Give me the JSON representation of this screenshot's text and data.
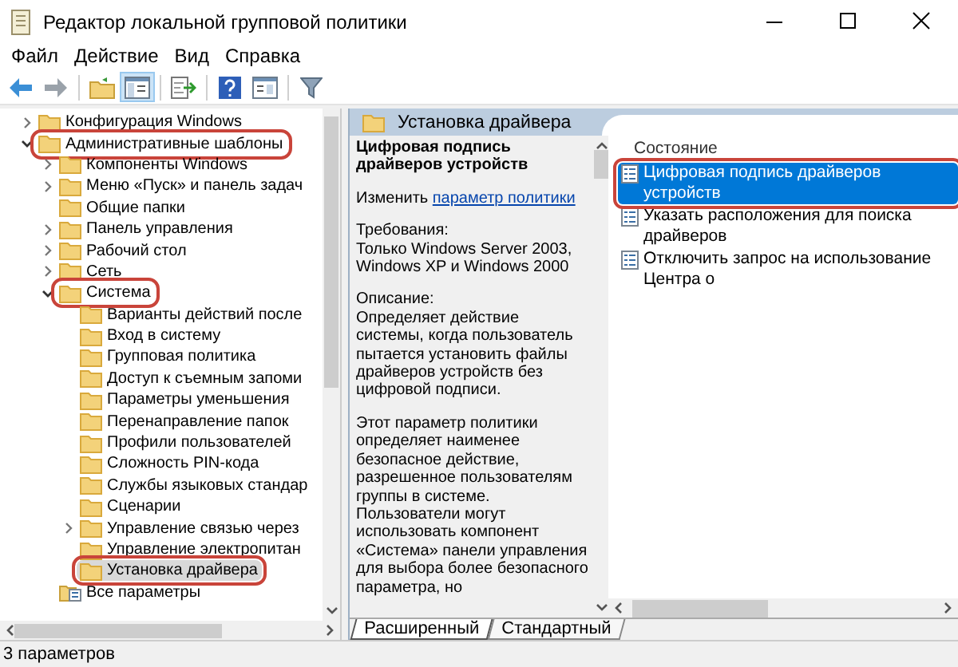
{
  "window": {
    "title": "Редактор локальной групповой политики"
  },
  "menu": [
    "Файл",
    "Действие",
    "Вид",
    "Справка"
  ],
  "toolbar": {
    "groups": [
      [
        {
          "kind": "back",
          "pressed": false
        },
        {
          "kind": "forward",
          "pressed": false
        }
      ],
      [
        {
          "kind": "up",
          "pressed": false
        },
        {
          "kind": "tree",
          "pressed": true
        }
      ],
      [
        {
          "kind": "export",
          "pressed": false
        }
      ],
      [
        {
          "kind": "help",
          "pressed": false
        },
        {
          "kind": "view",
          "pressed": false
        }
      ],
      [
        {
          "kind": "filter",
          "pressed": false
        }
      ]
    ]
  },
  "tree": {
    "items": [
      {
        "label": "Конфигурация Windows",
        "kind": "folder",
        "expanded": false,
        "selected": false,
        "highlighted": false
      },
      {
        "label": "Административные шаблоны",
        "kind": "folder",
        "expanded": true,
        "selected": false,
        "highlighted": true,
        "children": [
          {
            "label": "Компоненты Windows",
            "kind": "folder",
            "expanded": false,
            "selected": false,
            "highlighted": false
          },
          {
            "label": "Меню «Пуск» и панель задач",
            "kind": "folder",
            "expanded": false,
            "selected": false,
            "highlighted": false
          },
          {
            "label": "Общие папки",
            "kind": "folder",
            "selected": false,
            "highlighted": false
          },
          {
            "label": "Панель управления",
            "kind": "folder",
            "expanded": false,
            "selected": false,
            "highlighted": false
          },
          {
            "label": "Рабочий стол",
            "kind": "folder",
            "expanded": false,
            "selected": false,
            "highlighted": false
          },
          {
            "label": "Сеть",
            "kind": "folder",
            "expanded": false,
            "selected": false,
            "highlighted": false
          },
          {
            "label": "Система",
            "kind": "folder",
            "expanded": true,
            "selected": false,
            "highlighted": true,
            "children": [
              {
                "label": "Варианты действий после",
                "kind": "folder",
                "selected": false,
                "highlighted": false
              },
              {
                "label": "Вход в систему",
                "kind": "folder",
                "selected": false,
                "highlighted": false
              },
              {
                "label": "Групповая политика",
                "kind": "folder",
                "selected": false,
                "highlighted": false
              },
              {
                "label": "Доступ к съемным запоми",
                "kind": "folder",
                "selected": false,
                "highlighted": false
              },
              {
                "label": "Параметры уменьшения",
                "kind": "folder",
                "selected": false,
                "highlighted": false
              },
              {
                "label": "Перенаправление папок",
                "kind": "folder",
                "selected": false,
                "highlighted": false
              },
              {
                "label": "Профили пользователей",
                "kind": "folder",
                "selected": false,
                "highlighted": false
              },
              {
                "label": "Сложность PIN-кода",
                "kind": "folder",
                "selected": false,
                "highlighted": false
              },
              {
                "label": "Службы языковых стандар",
                "kind": "folder",
                "selected": false,
                "highlighted": false
              },
              {
                "label": "Сценарии",
                "kind": "folder",
                "selected": false,
                "highlighted": false
              },
              {
                "label": "Управление связью через",
                "kind": "folder",
                "expanded": false,
                "selected": false,
                "highlighted": false
              },
              {
                "label": "Управление электропитан",
                "kind": "folder",
                "selected": false,
                "highlighted": false
              },
              {
                "label": "Установка драйвера",
                "kind": "folder",
                "selected": true,
                "highlighted": true
              }
            ]
          },
          {
            "label": "Все параметры",
            "kind": "all-settings",
            "selected": false,
            "highlighted": false
          }
        ]
      }
    ]
  },
  "details": {
    "header": "Установка драйвера",
    "policy_title": "Цифровая подпись драйверов устройств",
    "edit_prefix": "Изменить",
    "edit_link": "параметр политики",
    "sections": [
      {
        "heading": "Требования:",
        "text": "Только Windows Server 2003, Windows XP и Windows 2000"
      },
      {
        "heading": "Описание:",
        "text": "Определяет действие системы, когда пользователь пытается установить файлы драйверов устройств без цифровой подписи."
      },
      {
        "text": "Этот параметр политики определяет наименее безопасное действие, разрешенное пользователям группы в системе. Пользователи могут использовать компонент «Система» панели управления для выбора более безопасного параметра, но"
      }
    ]
  },
  "list": {
    "column": "Состояние",
    "items": [
      {
        "label": "Цифровая подпись драйверов устройств",
        "selected": true,
        "highlighted": true
      },
      {
        "label": "Указать расположения для поиска драйверов",
        "selected": false,
        "highlighted": false
      },
      {
        "label": "Отключить запрос на использование Центра о",
        "selected": false,
        "highlighted": false
      }
    ]
  },
  "tabs": [
    {
      "label": "Расширенный",
      "selected": true
    },
    {
      "label": "Стандартный",
      "selected": false
    }
  ],
  "status_bar": {
    "text": "3 параметров"
  }
}
